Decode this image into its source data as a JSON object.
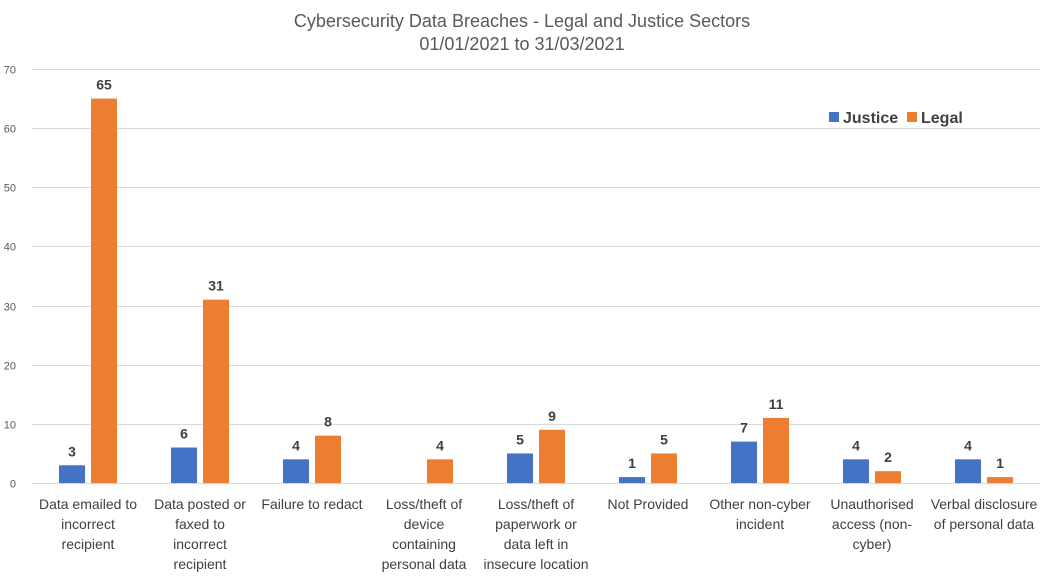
{
  "chart_data": {
    "type": "bar",
    "title": "Cybersecurity Data Breaches  - Legal and Justice Sectors",
    "subtitle": "01/01/2021 to 31/03/2021",
    "xlabel": "",
    "ylabel": "",
    "ylim": [
      0,
      70
    ],
    "yticks": [
      0,
      10,
      20,
      30,
      40,
      50,
      60,
      70
    ],
    "grid": true,
    "legend_position": "top-right",
    "categories": [
      [
        "Data emailed to",
        "incorrect",
        "recipient"
      ],
      [
        "Data posted or",
        "faxed to",
        "incorrect",
        "recipient"
      ],
      [
        "Failure to redact"
      ],
      [
        "Loss/theft of",
        "device",
        "containing",
        "personal data"
      ],
      [
        "Loss/theft of",
        "paperwork or",
        "data left in",
        "insecure location"
      ],
      [
        "Not Provided"
      ],
      [
        "Other non-cyber",
        "incident"
      ],
      [
        "Unauthorised",
        "access (non-",
        "cyber)"
      ],
      [
        "Verbal disclosure",
        "of personal data"
      ]
    ],
    "series": [
      {
        "name": "Justice",
        "color": "#4472c4",
        "values": [
          3,
          6,
          4,
          null,
          5,
          1,
          7,
          4,
          4
        ]
      },
      {
        "name": "Legal",
        "color": "#ed7d31",
        "values": [
          65,
          31,
          8,
          4,
          9,
          5,
          11,
          2,
          1
        ]
      }
    ]
  }
}
